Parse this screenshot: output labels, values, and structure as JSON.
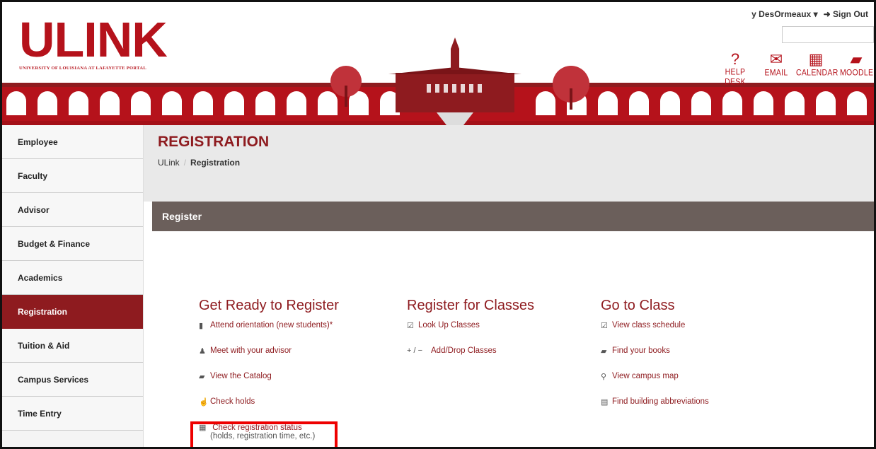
{
  "header": {
    "logo_text": "ULINK",
    "logo_sub": "UNIVERSITY OF LOUISIANA AT LAFAYETTE PORTAL",
    "user_name": "y DesOrmeaux",
    "user_caret": "▾",
    "signout_icon": "sign-out-icon",
    "signout_label": "Sign Out",
    "quick_links": [
      {
        "icon": "help-icon",
        "glyph": "?",
        "label": "HELP DESK"
      },
      {
        "icon": "email-icon",
        "glyph": "✉",
        "label": "EMAIL"
      },
      {
        "icon": "calendar-icon",
        "glyph": "▦",
        "label": "CALENDAR"
      },
      {
        "icon": "book-icon",
        "glyph": "▰",
        "label": "MOODLE"
      }
    ]
  },
  "sidebar": {
    "items": [
      {
        "label": "Employee"
      },
      {
        "label": "Faculty"
      },
      {
        "label": "Advisor"
      },
      {
        "label": "Budget & Finance"
      },
      {
        "label": "Academics"
      },
      {
        "label": "Registration",
        "active": true
      },
      {
        "label": "Tuition & Aid"
      },
      {
        "label": "Campus Services"
      },
      {
        "label": "Time Entry"
      }
    ]
  },
  "page": {
    "title": "REGISTRATION",
    "breadcrumb_root": "ULink",
    "breadcrumb_current": "Registration"
  },
  "panel": {
    "title": "Register",
    "columns": [
      {
        "heading": "Get Ready to Register",
        "links": [
          {
            "icon": "bookmark-icon",
            "glyph": "▮",
            "label": "Attend orientation (new students)*"
          },
          {
            "icon": "user-icon",
            "glyph": "♟",
            "label": "Meet with your advisor"
          },
          {
            "icon": "book-icon",
            "glyph": "▰",
            "label": "View the Catalog"
          },
          {
            "icon": "hand-icon",
            "glyph": "☝",
            "label": "Check holds"
          },
          {
            "icon": "table-icon",
            "glyph": "▦",
            "label": "Check registration status",
            "sub": "(holds, registration time, etc.)"
          }
        ]
      },
      {
        "heading": "Register for Classes",
        "links": [
          {
            "icon": "checkbox-icon",
            "glyph": "☑",
            "label": "Look Up Classes"
          },
          {
            "icon": "plus-minus-icon",
            "glyph": "+ / −",
            "label": "Add/Drop Classes"
          }
        ]
      },
      {
        "heading": "Go to Class",
        "links": [
          {
            "icon": "checkbox-icon",
            "glyph": "☑",
            "label": "View class schedule"
          },
          {
            "icon": "book-icon",
            "glyph": "▰",
            "label": "Find your books"
          },
          {
            "icon": "map-marker-icon",
            "glyph": "⚲",
            "label": "View campus map"
          },
          {
            "icon": "document-icon",
            "glyph": "▤",
            "label": "Find building abbreviations"
          }
        ]
      }
    ]
  },
  "colors": {
    "brand_red": "#b5121b",
    "dark_red": "#8e1b1f",
    "panel_header": "#6b5f5b",
    "highlight": "#ee0000"
  }
}
